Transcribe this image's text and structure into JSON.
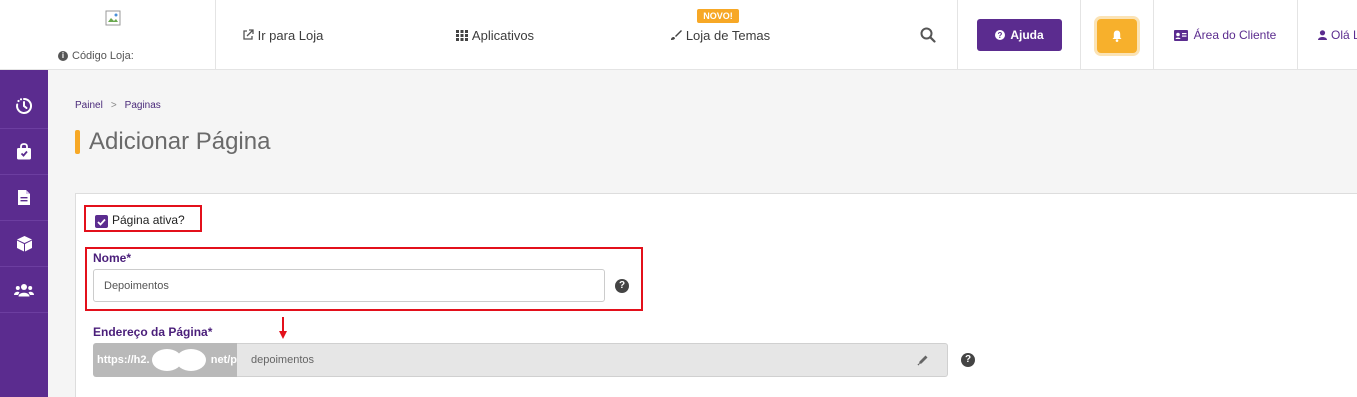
{
  "header": {
    "store_code_label": "Código Loja:",
    "go_to_store": "Ir para Loja",
    "apps": "Aplicativos",
    "themes_badge": "NOVO!",
    "themes": "Loja de Temas",
    "help": "Ajuda",
    "client_area": "Área do Cliente",
    "user_greeting": "Olá L"
  },
  "sidebar": {
    "items": [
      {
        "icon": "dashboard-timer-icon"
      },
      {
        "icon": "shopping-bag-icon"
      },
      {
        "icon": "document-icon"
      },
      {
        "icon": "box-icon"
      },
      {
        "icon": "users-icon"
      }
    ]
  },
  "breadcrumb": {
    "items": [
      "Painel",
      "Paginas"
    ],
    "separator": ">"
  },
  "page": {
    "title": "Adicionar Página"
  },
  "form": {
    "active_label": "Página ativa?",
    "active_checked": true,
    "name_label": "Nome*",
    "name_value": "Depoimentos",
    "address_label": "Endereço da Página*",
    "address_prefix_start": "https://h2.",
    "address_prefix_end": "net/p",
    "address_value": "depoimentos"
  },
  "colors": {
    "primary": "#5b2c8f",
    "accent": "#f7a826",
    "highlight": "#e3101b"
  }
}
